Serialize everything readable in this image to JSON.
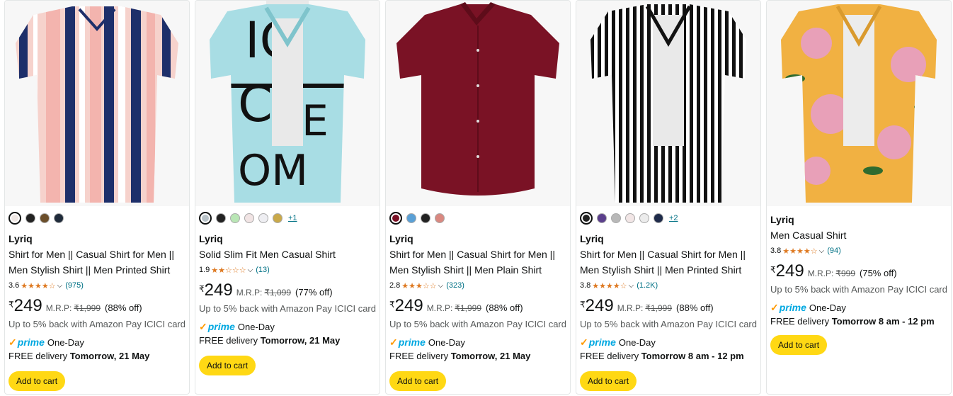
{
  "products": [
    {
      "brand": "Lyriq",
      "title_line1": "Shirt for Men || Casual Shirt for Men ||",
      "title_line2": "Men Stylish Shirt || Men Printed Shirt",
      "rating": "3.6",
      "stars": "★★★★☆",
      "review_count": "(975)",
      "currency": "₹",
      "price": "249",
      "mrp_label": "M.R.P:",
      "mrp": "₹1,999",
      "discount": "(88% off)",
      "cashback": "Up to 5% back with Amazon Pay ICICI card",
      "check": "✓",
      "prime": "prime",
      "prime_speed": "One-Day",
      "delivery_prefix": "FREE delivery",
      "delivery_date": "Tomorrow, 21 May",
      "cart_label": "Add to cart",
      "swatch_colors": [
        "#efe7e4",
        "#222222",
        "#6b4e2a",
        "#1f2b3a"
      ],
      "swatch_more": ""
    },
    {
      "brand": "Lyriq",
      "title_line1": "Solid Slim Fit Men Casual Shirt",
      "rating": "1.9",
      "stars": "★★☆☆☆",
      "review_count": "(13)",
      "currency": "₹",
      "price": "249",
      "mrp_label": "M.R.P:",
      "mrp": "₹1,099",
      "discount": "(77% off)",
      "cashback": "Up to 5% back with Amazon Pay ICICI card",
      "check": "✓",
      "prime": "prime",
      "prime_speed": "One-Day",
      "delivery_prefix": "FREE delivery",
      "delivery_date": "Tomorrow, 21 May",
      "cart_label": "Add to cart",
      "swatch_colors": [
        "#b8c2c8",
        "#222222",
        "#b9e6b5",
        "#f1e4e4",
        "#eeeef2",
        "#c9a94a"
      ],
      "swatch_more": "+1"
    },
    {
      "brand": "Lyriq",
      "title_line1": "Shirt for Men || Casual Shirt for Men ||",
      "title_line2": "Men Stylish Shirt || Men Plain Shirt",
      "rating": "2.8",
      "stars": "★★★☆☆",
      "review_count": "(323)",
      "currency": "₹",
      "price": "249",
      "mrp_label": "M.R.P:",
      "mrp": "₹1,999",
      "discount": "(88% off)",
      "cashback": "Up to 5% back with Amazon Pay ICICI card",
      "check": "✓",
      "prime": "prime",
      "prime_speed": "One-Day",
      "delivery_prefix": "FREE delivery",
      "delivery_date": "Tomorrow, 21 May",
      "cart_label": "Add to cart",
      "swatch_colors": [
        "#7a1025",
        "#5aa0d6",
        "#222222",
        "#d98880"
      ],
      "swatch_more": ""
    },
    {
      "brand": "Lyriq",
      "title_line1": "Shirt for Men || Casual Shirt for Men ||",
      "title_line2": "Men Stylish Shirt || Men Printed Shirt",
      "rating": "3.8",
      "stars": "★★★★☆",
      "review_count": "(1.2K)",
      "currency": "₹",
      "price": "249",
      "mrp_label": "M.R.P:",
      "mrp": "₹1,999",
      "discount": "(88% off)",
      "cashback": "Up to 5% back with Amazon Pay ICICI card",
      "check": "✓",
      "prime": "prime",
      "prime_speed": "One-Day",
      "delivery_prefix": "FREE delivery",
      "delivery_date": "Tomorrow 8 am - 12 pm",
      "cart_label": "Add to cart",
      "swatch_colors": [
        "#222222",
        "#5b3f8c",
        "#b8b8b8",
        "#f2e6e6",
        "#ececec",
        "#1f2b4a"
      ],
      "swatch_more": "+2"
    },
    {
      "brand": "Lyriq",
      "title_line1": "Men Casual Shirt",
      "rating": "3.8",
      "stars": "★★★★☆",
      "review_count": "(94)",
      "currency": "₹",
      "price": "249",
      "mrp_label": "M.R.P:",
      "mrp": "₹999",
      "discount": "(75% off)",
      "cashback": "Up to 5% back with Amazon Pay ICICI card",
      "check": "✓",
      "prime": "prime",
      "prime_speed": "One-Day",
      "delivery_prefix": "FREE delivery",
      "delivery_date": "Tomorrow 8 am - 12 pm",
      "cart_label": "Add to cart",
      "swatch_colors": [],
      "swatch_more": ""
    }
  ]
}
